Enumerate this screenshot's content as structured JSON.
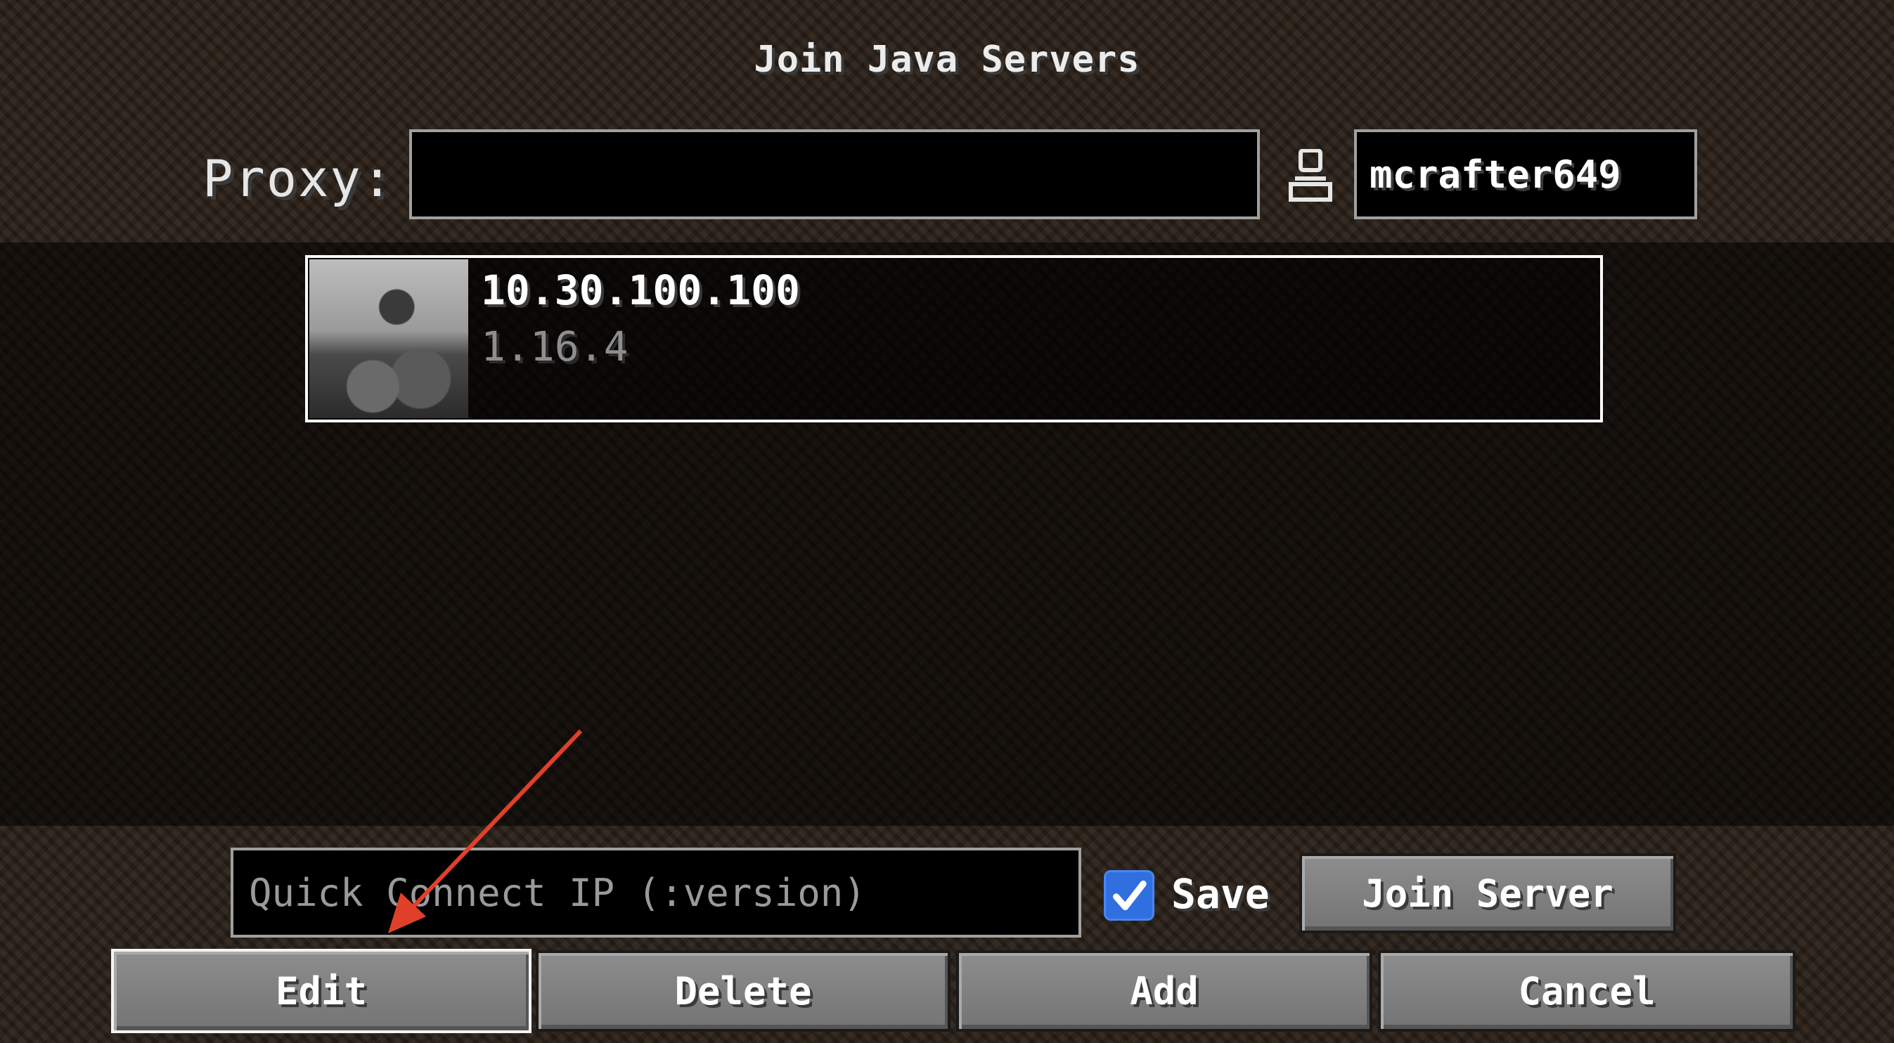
{
  "header": {
    "title": "Join Java Servers"
  },
  "proxy": {
    "label": "Proxy:",
    "value": ""
  },
  "account": {
    "icon": "user-icon",
    "username": "mcrafter649"
  },
  "servers": [
    {
      "name": "10.30.100.100",
      "version": "1.16.4",
      "icon": "server-thumbnail"
    }
  ],
  "quick_connect": {
    "placeholder": "Quick Connect IP (:version)",
    "save_label": "Save",
    "save_checked": true
  },
  "buttons": {
    "join": "Join Server",
    "edit": "Edit",
    "delete": "Delete",
    "add": "Add",
    "cancel": "Cancel"
  },
  "colors": {
    "checkbox": "#2f6fe0",
    "annotation_arrow": "#e0402a",
    "selected_border": "#ffffff"
  }
}
